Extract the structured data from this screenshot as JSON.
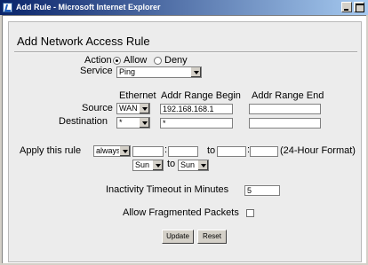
{
  "window": {
    "title": "Add Rule - Microsoft Internet Explorer"
  },
  "page": {
    "heading": "Add Network Access Rule"
  },
  "form": {
    "action_label": "Action",
    "action_options": [
      "Allow",
      "Deny"
    ],
    "action_selected": "Allow",
    "service_label": "Service",
    "service_value": "Ping",
    "col_ethernet": "Ethernet",
    "col_addr_begin": "Addr Range Begin",
    "col_addr_end": "Addr Range End",
    "source_label": "Source",
    "source_ethernet": "WAN",
    "source_addr_begin": "192.168.168.1",
    "source_addr_end": "",
    "destination_label": "Destination",
    "destination_ethernet": "*",
    "destination_addr_begin": "*",
    "destination_addr_end": "",
    "apply_label": "Apply this rule",
    "apply_value": "always",
    "time_sep": ":",
    "to_label": "to",
    "time_format": "(24-Hour Format)",
    "day_from": "Sun",
    "day_to": "Sun",
    "timeout_label": "Inactivity Timeout in Minutes",
    "timeout_value": "5",
    "fragmented_label": "Allow Fragmented Packets",
    "fragmented_checked": false
  },
  "buttons": {
    "update": "Update",
    "reset": "Reset"
  }
}
